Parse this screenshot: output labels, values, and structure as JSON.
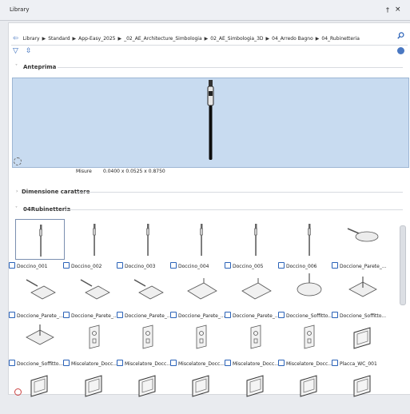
{
  "window": {
    "title": "Library",
    "pin_glyph": "†",
    "close_glyph": "×"
  },
  "breadcrumb": {
    "back_glyph": "⇦",
    "separator": "▶",
    "items": [
      "Library",
      "Standard",
      "App-Easy_2025",
      "_02_AE_Architecture_Simbologia",
      "02_AE_Simbologia_3D",
      "04_Arredo Bagno",
      "04_Rubinetteria"
    ]
  },
  "toolbar": {
    "search_icon": "search-icon",
    "filter_glyph": "▽",
    "sort_glyph": "⇳"
  },
  "sections": {
    "preview": {
      "chevron": "˅",
      "label": "Anteprima"
    },
    "dimension": {
      "chevron": "›",
      "label": "Dimensione carattere"
    },
    "folder": {
      "chevron": "˅",
      "label": "04Rubinetteria"
    }
  },
  "measure": {
    "label": "Misure",
    "value": "0.0400 x 0.0525 x 0.8750"
  },
  "items": [
    {
      "label": "Doccino_001",
      "kind": "rod"
    },
    {
      "label": "Doccino_002",
      "kind": "rod"
    },
    {
      "label": "Doccino_003",
      "kind": "rod"
    },
    {
      "label": "Doccino_004",
      "kind": "rod"
    },
    {
      "label": "Doccino_005",
      "kind": "rod"
    },
    {
      "label": "Doccino_006",
      "kind": "rod"
    },
    {
      "label": "Doccione_Parete_...",
      "kind": "head"
    },
    {
      "label": "Doccione_Parete_...",
      "kind": "wallhead"
    },
    {
      "label": "Doccione_Parete_...",
      "kind": "wallhead"
    },
    {
      "label": "Doccione_Parete_...",
      "kind": "wallhead"
    },
    {
      "label": "Doccione_Parete_...",
      "kind": "plate"
    },
    {
      "label": "Doccione_Parete_...",
      "kind": "plate"
    },
    {
      "label": "Doccione_Soffitto...",
      "kind": "round"
    },
    {
      "label": "Doccione_Soffitto...",
      "kind": "diamond"
    },
    {
      "label": "Doccione_Soffitto...",
      "kind": "diamond"
    },
    {
      "label": "Miscelatore_Docc...",
      "kind": "mixer"
    },
    {
      "label": "Miscelatore_Docc...",
      "kind": "mixer"
    },
    {
      "label": "Miscelatore_Docc...",
      "kind": "mixer"
    },
    {
      "label": "Miscelatore_Docc...",
      "kind": "mixer"
    },
    {
      "label": "Miscelatore_Docc...",
      "kind": "mixer"
    },
    {
      "label": "Placca_WC_001",
      "kind": "panel"
    },
    {
      "label": "",
      "kind": "panel"
    },
    {
      "label": "",
      "kind": "panel"
    },
    {
      "label": "",
      "kind": "panel"
    },
    {
      "label": "",
      "kind": "panel"
    },
    {
      "label": "",
      "kind": "panel"
    },
    {
      "label": "",
      "kind": "panel"
    },
    {
      "label": "",
      "kind": "panel"
    }
  ]
}
